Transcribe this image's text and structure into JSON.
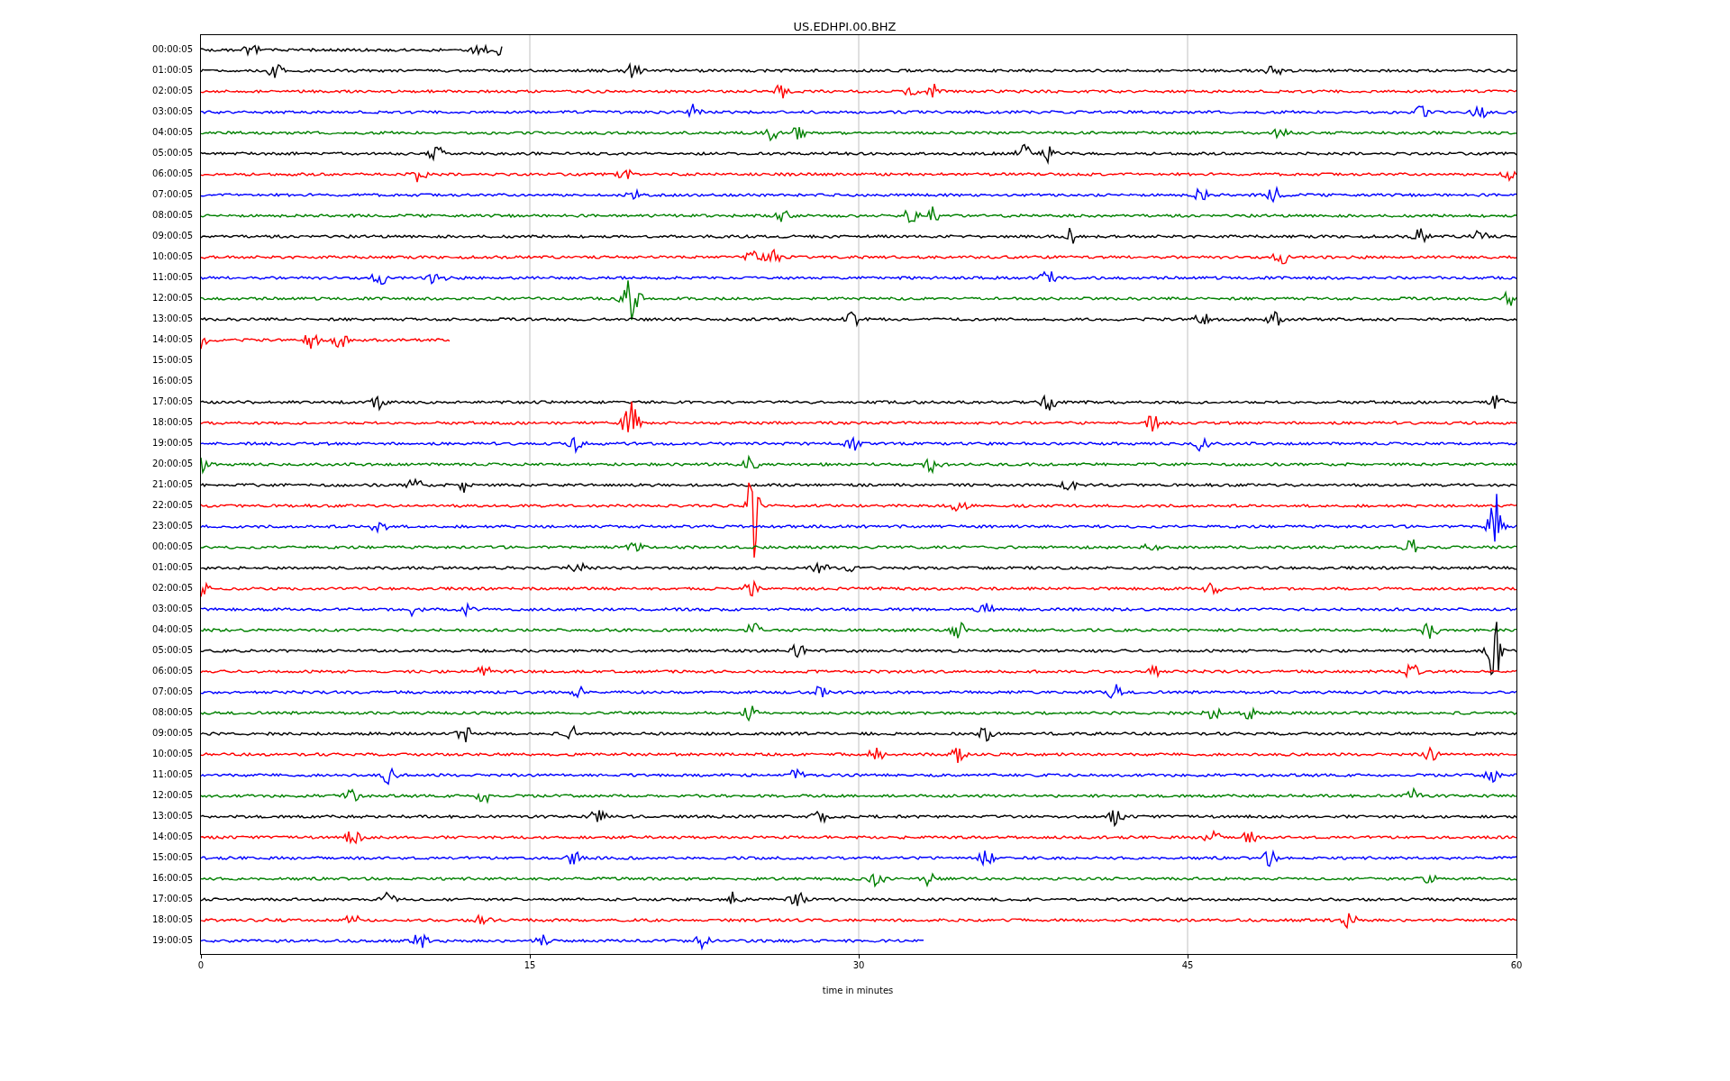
{
  "title": "US.EDHPI.00.BHZ",
  "traces": [
    {
      "label": "00:00:05",
      "color": "#000000",
      "level": 0.23
    },
    {
      "label": "01:00:05",
      "color": "#000000"
    },
    {
      "label": "02:00:05",
      "color": "#ff0000"
    },
    {
      "label": "03:00:05",
      "color": "#0000ff"
    },
    {
      "label": "04:00:05",
      "color": "#008000"
    },
    {
      "label": "05:00:05",
      "color": "#000000"
    },
    {
      "label": "06:00:05",
      "color": "#ff0000"
    },
    {
      "label": "07:00:05",
      "color": "#0000ff"
    },
    {
      "label": "08:00:05",
      "color": "#008000"
    },
    {
      "label": "09:00:05",
      "color": "#000000"
    },
    {
      "label": "10:00:05",
      "color": "#ff0000"
    },
    {
      "label": "11:00:05",
      "color": "#0000ff"
    },
    {
      "label": "12:00:05",
      "color": "#008000"
    },
    {
      "label": "13:00:05",
      "color": "#000000"
    },
    {
      "label": "14:00:05",
      "color": "#ff0000",
      "level": 0.19
    },
    {
      "label": "15:00:05"
    },
    {
      "label": "16:00:05"
    },
    {
      "label": "17:00:05",
      "color": "#000000"
    },
    {
      "label": "18:00:05",
      "color": "#ff0000"
    },
    {
      "label": "19:00:05",
      "color": "#0000ff"
    },
    {
      "label": "20:00:05",
      "color": "#008000"
    },
    {
      "label": "21:00:05",
      "color": "#000000"
    },
    {
      "label": "22:00:05",
      "color": "#ff0000"
    },
    {
      "label": "23:00:05",
      "color": "#0000ff"
    },
    {
      "label": "00:00:05",
      "color": "#008000"
    },
    {
      "label": "01:00:05",
      "color": "#000000"
    },
    {
      "label": "02:00:05",
      "color": "#ff0000"
    },
    {
      "label": "03:00:05",
      "color": "#0000ff"
    },
    {
      "label": "04:00:05",
      "color": "#008000"
    },
    {
      "label": "05:00:05",
      "color": "#000000"
    },
    {
      "label": "06:00:05",
      "color": "#ff0000"
    },
    {
      "label": "07:00:05",
      "color": "#0000ff"
    },
    {
      "label": "08:00:05",
      "color": "#008000"
    },
    {
      "label": "09:00:05",
      "color": "#000000"
    },
    {
      "label": "10:00:05",
      "color": "#ff0000"
    },
    {
      "label": "11:00:05",
      "color": "#0000ff"
    },
    {
      "label": "12:00:05",
      "color": "#008000"
    },
    {
      "label": "13:00:05",
      "color": "#000000"
    },
    {
      "label": "14:00:05",
      "color": "#ff0000"
    },
    {
      "label": "15:00:05",
      "color": "#0000ff"
    },
    {
      "label": "16:00:05",
      "color": "#008000"
    },
    {
      "label": "17:00:05",
      "color": "#000000"
    },
    {
      "label": "18:00:05",
      "color": "#ff0000"
    },
    {
      "label": "19:00:05",
      "color": "#0000ff",
      "level": 0.55
    }
  ],
  "x_axis": {
    "ticks": [
      "0",
      "15",
      "30",
      "45",
      "60"
    ],
    "label": "time in minutes"
  }
}
